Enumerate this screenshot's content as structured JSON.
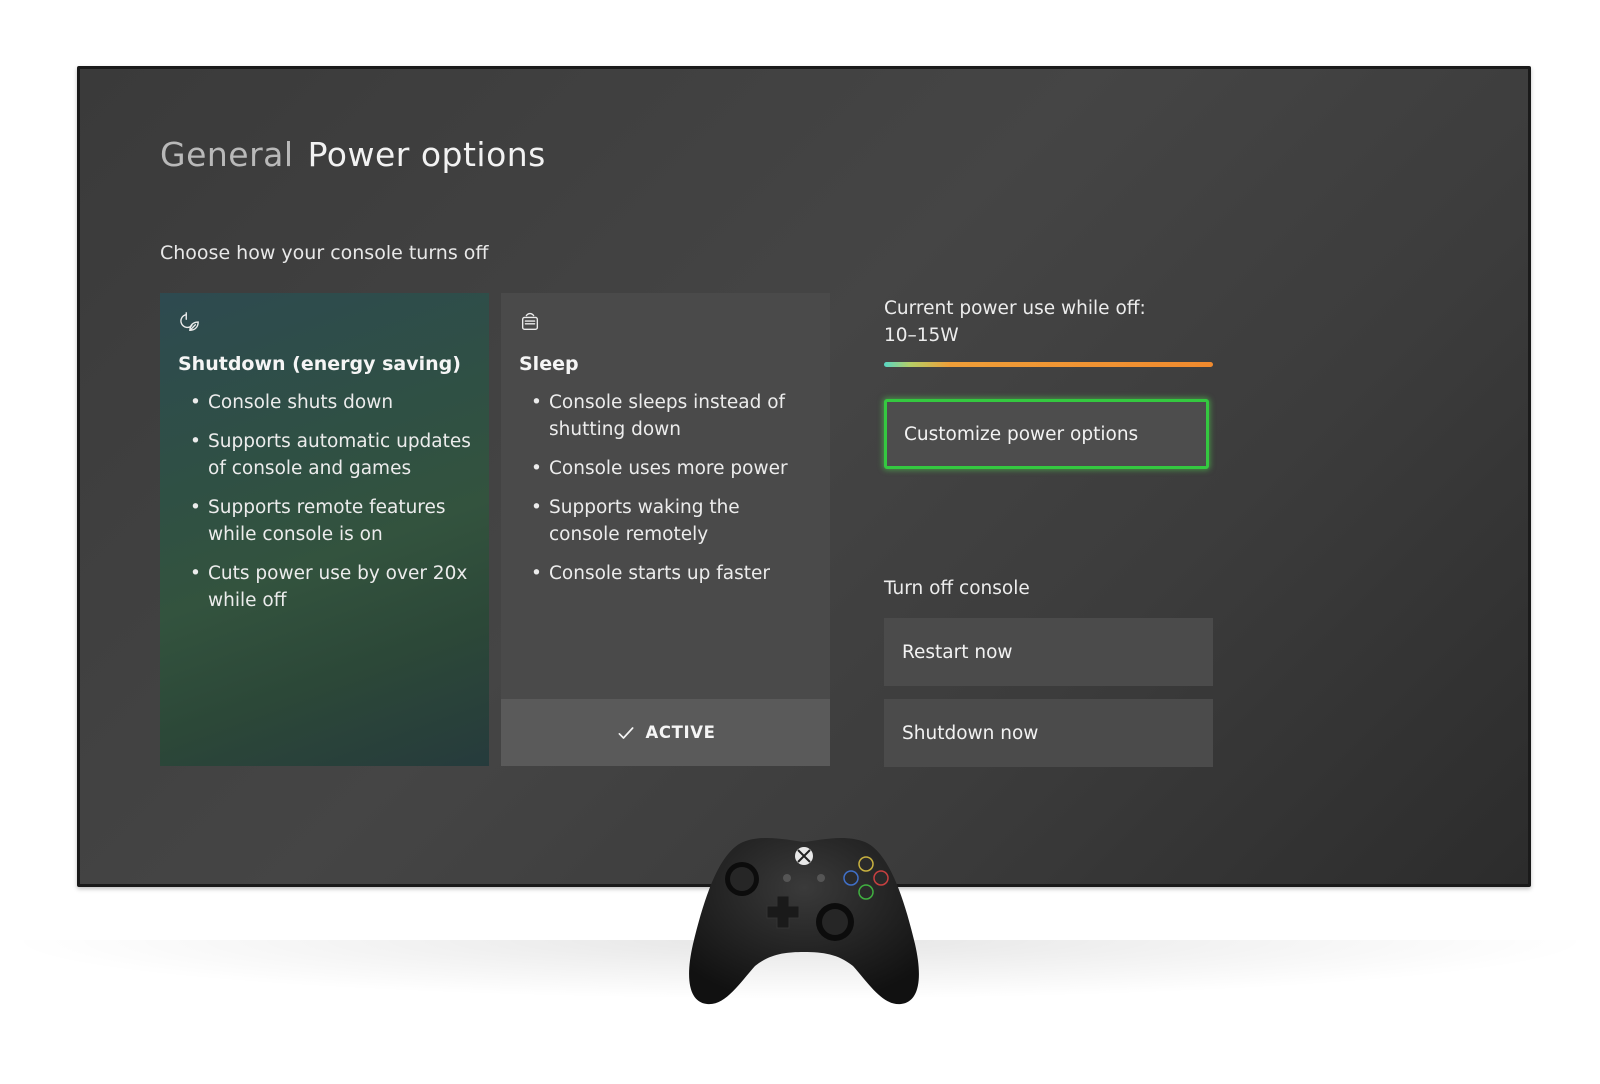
{
  "header": {
    "breadcrumb": "General",
    "title": "Power options"
  },
  "subtitle": "Choose how your console turns off",
  "cards": {
    "shutdown": {
      "icon": "power-leaf-icon",
      "title": "Shutdown (energy saving)",
      "bullets": [
        "Console shuts down",
        "Supports automatic updates of console and games",
        "Supports remote features while console is on",
        "Cuts power use by over 20x while off"
      ]
    },
    "sleep": {
      "icon": "sleep-console-icon",
      "title": "Sleep",
      "bullets": [
        "Console sleeps instead of shutting down",
        "Console uses more power",
        "Supports waking the console remotely",
        "Console starts up faster"
      ],
      "status_label": "ACTIVE",
      "status_icon": "checkmark-icon"
    }
  },
  "power_info": {
    "label": "Current power use while off:",
    "value": "10–15W",
    "bar_fill_fraction": 1.0,
    "bar_colors": [
      "#58d6c4",
      "#ef9e38",
      "#f08a2e"
    ]
  },
  "customize_button": {
    "label": "Customize power options",
    "focus_color": "#34c940"
  },
  "turn_off": {
    "heading": "Turn off console",
    "restart_label": "Restart now",
    "shutdown_label": "Shutdown now"
  },
  "device": {
    "icon": "xbox-controller-icon"
  }
}
